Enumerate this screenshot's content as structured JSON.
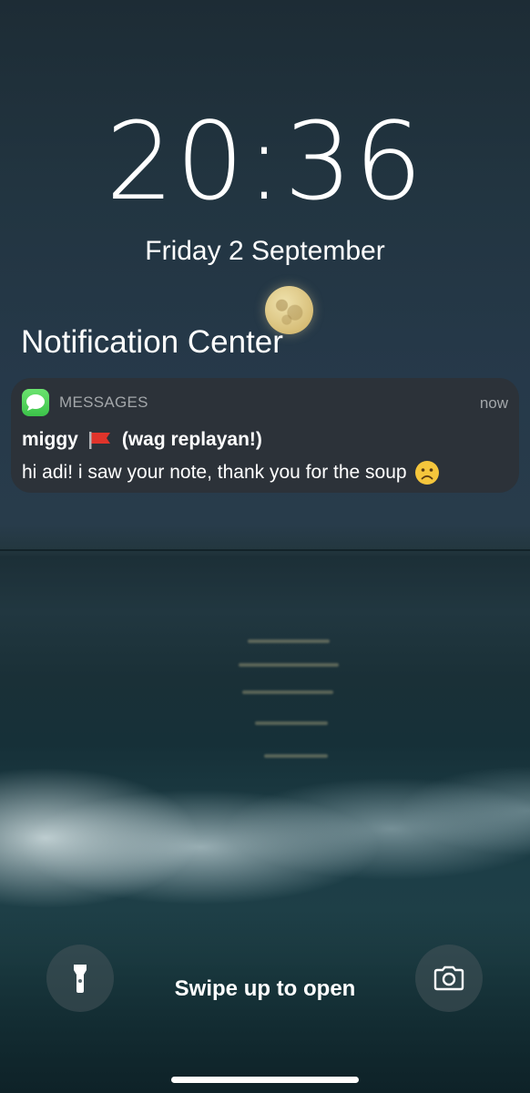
{
  "lock_screen": {
    "time": "20:36",
    "date": "Friday 2 September"
  },
  "notification_center": {
    "title": "Notification Center"
  },
  "notification": {
    "app_name": "MESSAGES",
    "app_icon": "messages-app-icon",
    "time_ago": "now",
    "sender": "miggy",
    "sender_flag_icon": "red-flag-icon",
    "sender_suffix": "(wag replayan!)",
    "message": "hi adi! i saw your note, thank you for the soup",
    "message_emoji_icon": "sad-face-icon"
  },
  "bottom_bar": {
    "flashlight_icon": "flashlight-icon",
    "swipe_hint": "Swipe up to open",
    "camera_icon": "camera-icon"
  },
  "colors": {
    "notification_bg": "#2c3237",
    "messages_green": "#4cd35a",
    "secondary_text": "#a3a7aa",
    "flag_red": "#e0342b"
  }
}
